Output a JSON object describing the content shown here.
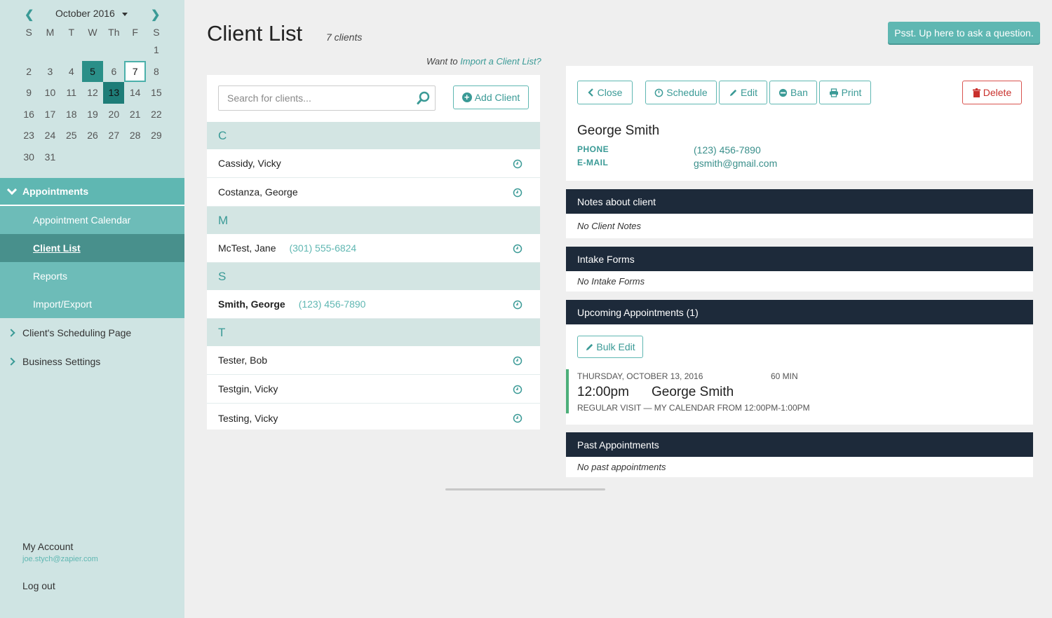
{
  "calendar": {
    "month_label": "October 2016",
    "dow": [
      "S",
      "M",
      "T",
      "W",
      "Th",
      "F",
      "S"
    ],
    "weeks": [
      [
        "",
        "",
        "",
        "",
        "",
        "",
        "1"
      ],
      [
        "2",
        "3",
        "4",
        "5",
        "6",
        "7",
        "8"
      ],
      [
        "9",
        "10",
        "11",
        "12",
        "13",
        "14",
        "15"
      ],
      [
        "16",
        "17",
        "18",
        "19",
        "20",
        "21",
        "22"
      ],
      [
        "23",
        "24",
        "25",
        "26",
        "27",
        "28",
        "29"
      ],
      [
        "30",
        "31",
        "",
        "",
        "",
        "",
        ""
      ]
    ]
  },
  "nav": {
    "appointments": "Appointments",
    "sub": [
      "Appointment Calendar",
      "Client List",
      "Reports",
      "Import/Export"
    ],
    "scheduling_page": "Client's Scheduling Page",
    "business_settings": "Business Settings"
  },
  "account": {
    "title": "My Account",
    "email": "joe.stych@zapier.com",
    "logout": "Log out"
  },
  "header": {
    "title": "Client List",
    "count": "7 clients",
    "help": "Psst. Up here to ask a question.",
    "import_prefix": "Want to ",
    "import_link": "Import a Client List?"
  },
  "search": {
    "placeholder": "Search for clients..."
  },
  "add_client": "Add Client",
  "groups": [
    {
      "letter": "C",
      "clients": [
        {
          "name": "Cassidy, Vicky",
          "phone": ""
        },
        {
          "name": "Costanza, George",
          "phone": ""
        }
      ]
    },
    {
      "letter": "M",
      "clients": [
        {
          "name": "McTest, Jane",
          "phone": "(301) 555-6824"
        }
      ]
    },
    {
      "letter": "S",
      "clients": [
        {
          "name": "Smith, George",
          "phone": "(123) 456-7890"
        }
      ]
    },
    {
      "letter": "T",
      "clients": [
        {
          "name": "Tester, Bob",
          "phone": ""
        },
        {
          "name": "Testgin, Vicky",
          "phone": ""
        },
        {
          "name": "Testing, Vicky",
          "phone": ""
        }
      ]
    }
  ],
  "detail": {
    "buttons": {
      "close": "Close",
      "schedule": "Schedule",
      "edit": "Edit",
      "ban": "Ban",
      "print": "Print",
      "delete": "Delete"
    },
    "name": "George Smith",
    "phone_label": "PHONE",
    "phone": "(123) 456-7890",
    "email_label": "E-MAIL",
    "email": "gsmith@gmail.com"
  },
  "sections": {
    "notes_title": "Notes about client",
    "notes_body": "No Client Notes",
    "intake_title": "Intake Forms",
    "intake_body": "No Intake Forms",
    "upcoming_title": "Upcoming Appointments (1)",
    "bulk_edit": "Bulk Edit",
    "appt": {
      "date": "THURSDAY, OCTOBER 13, 2016",
      "duration": "60 MIN",
      "time": "12:00pm",
      "name": "George Smith",
      "sub": "REGULAR VISIT — MY CALENDAR FROM 12:00PM-1:00PM"
    },
    "past_title": "Past Appointments",
    "past_body": "No past appointments"
  }
}
